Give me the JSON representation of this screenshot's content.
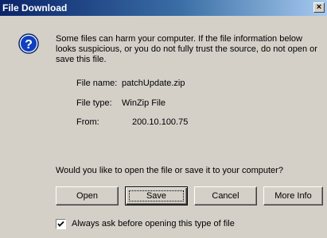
{
  "dialog": {
    "title": "File Download",
    "close_label": "×",
    "warning": "Some files can harm your computer. If the file information below looks suspicious, or you do not fully trust the source, do not open or save this file.",
    "file_name_label": "File name:",
    "file_name": "patchUpdate.zip",
    "file_type_label": "File type:",
    "file_type": "WinZip File",
    "from_label": "From:",
    "from": "200.10.100.75",
    "question": "Would you like to open the file or save it to your computer?",
    "buttons": {
      "open": "Open",
      "save": "Save",
      "cancel": "Cancel",
      "more_info": "More Info"
    },
    "checkbox_label": "Always ask before opening this type of file",
    "checkbox_checked": true,
    "icon": "info-question-icon"
  }
}
